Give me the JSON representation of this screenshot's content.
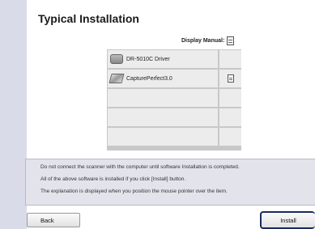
{
  "title": "Typical Installation",
  "manual": {
    "label": "Display Manual:",
    "icon": "manual-icon"
  },
  "list": {
    "items": [
      {
        "name": "DR-5010C Driver",
        "icon": "scanner-icon",
        "has_manual": false
      },
      {
        "name": "CapturePerfect3.0",
        "icon": "software-icon",
        "has_manual": true
      }
    ],
    "empty_rows": 3
  },
  "info": {
    "line1": "Do not connect the scanner with the computer until software Installation is completed.",
    "line2": "All of the above software is installed if you click [Install] button.",
    "line3": "The explanation is displayed when you position the mouse pointer over the item."
  },
  "buttons": {
    "back": "Back",
    "install": "Install"
  }
}
